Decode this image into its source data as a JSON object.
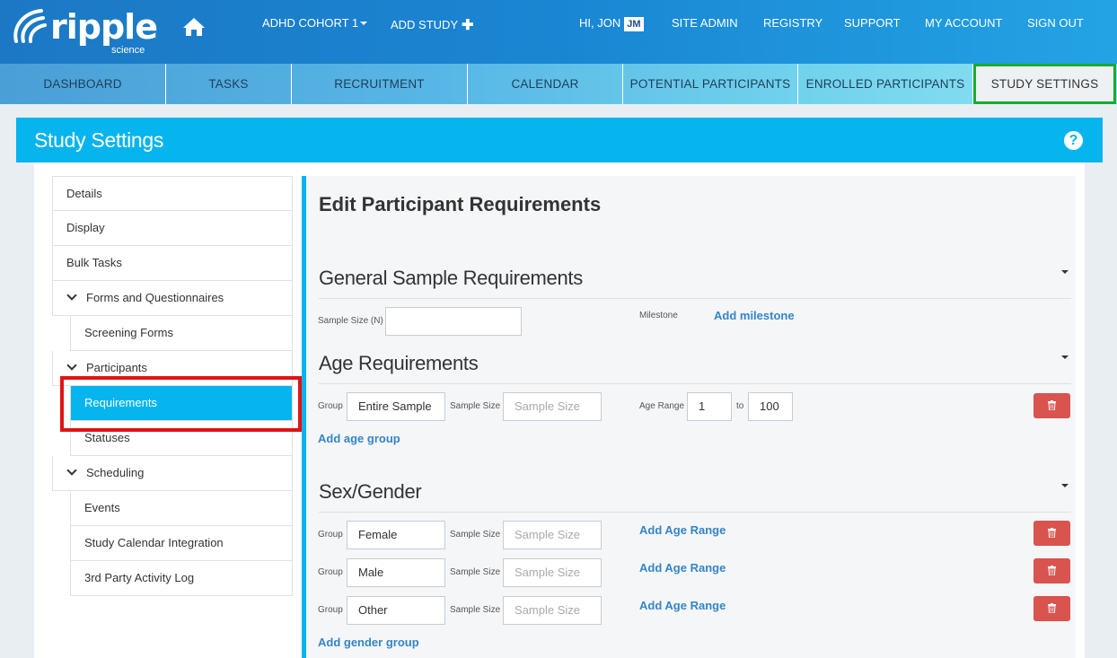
{
  "brand": {
    "name": "ripple",
    "sub": "science"
  },
  "topnav": {
    "cohort": "ADHD COHORT 1",
    "add_study": "ADD STUDY",
    "greeting": "HI, JON",
    "avatar": "JM",
    "site_admin": "SITE ADMIN",
    "registry": "REGISTRY",
    "support": "SUPPORT",
    "my_account": "MY ACCOUNT",
    "sign_out": "SIGN OUT"
  },
  "tabs": [
    {
      "label": "DASHBOARD"
    },
    {
      "label": "TASKS"
    },
    {
      "label": "RECRUITMENT"
    },
    {
      "label": "CALENDAR"
    },
    {
      "label": "POTENTIAL PARTICIPANTS"
    },
    {
      "label": "ENROLLED PARTICIPANTS"
    },
    {
      "label": "STUDY SETTINGS",
      "active": true
    }
  ],
  "page": {
    "title": "Study Settings",
    "help": "?"
  },
  "sidebar": {
    "items": [
      {
        "label": "Details"
      },
      {
        "label": "Display"
      },
      {
        "label": "Bulk Tasks"
      },
      {
        "label": "Forms and Questionnaires"
      },
      {
        "label": "Screening Forms"
      },
      {
        "label": "Participants"
      },
      {
        "label": "Requirements",
        "selected": true
      },
      {
        "label": "Statuses"
      },
      {
        "label": "Scheduling"
      },
      {
        "label": "Events"
      },
      {
        "label": "Study Calendar Integration"
      },
      {
        "label": "3rd Party Activity Log"
      }
    ]
  },
  "form": {
    "title": "Edit Participant Requirements",
    "general": {
      "heading": "General Sample Requirements",
      "sample_size_label": "Sample Size (N)",
      "sample_size_value": "",
      "milestone_label": "Milestone",
      "add_milestone": "Add milestone"
    },
    "age": {
      "heading": "Age Requirements",
      "group_label": "Group",
      "group_value": "Entire Sample",
      "sample_size_label": "Sample Size",
      "sample_size_placeholder": "Sample Size",
      "age_range_label": "Age Range",
      "age_from": "1",
      "to_label": "to",
      "age_to": "100",
      "add_group": "Add age group"
    },
    "gender": {
      "heading": "Sex/Gender",
      "group_label": "Group",
      "sample_size_label": "Sample Size",
      "sample_size_placeholder": "Sample Size",
      "add_age_range": "Add Age Range",
      "groups": [
        "Female",
        "Male",
        "Other"
      ],
      "add_group": "Add gender group"
    }
  },
  "colors": {
    "header_blue": "#1a86d3",
    "section_blue": "#06b4ee",
    "delete_red": "#d9534f",
    "highlight_green": "#1aab2e",
    "highlight_red": "#e01414",
    "link_blue": "#3585c6"
  }
}
